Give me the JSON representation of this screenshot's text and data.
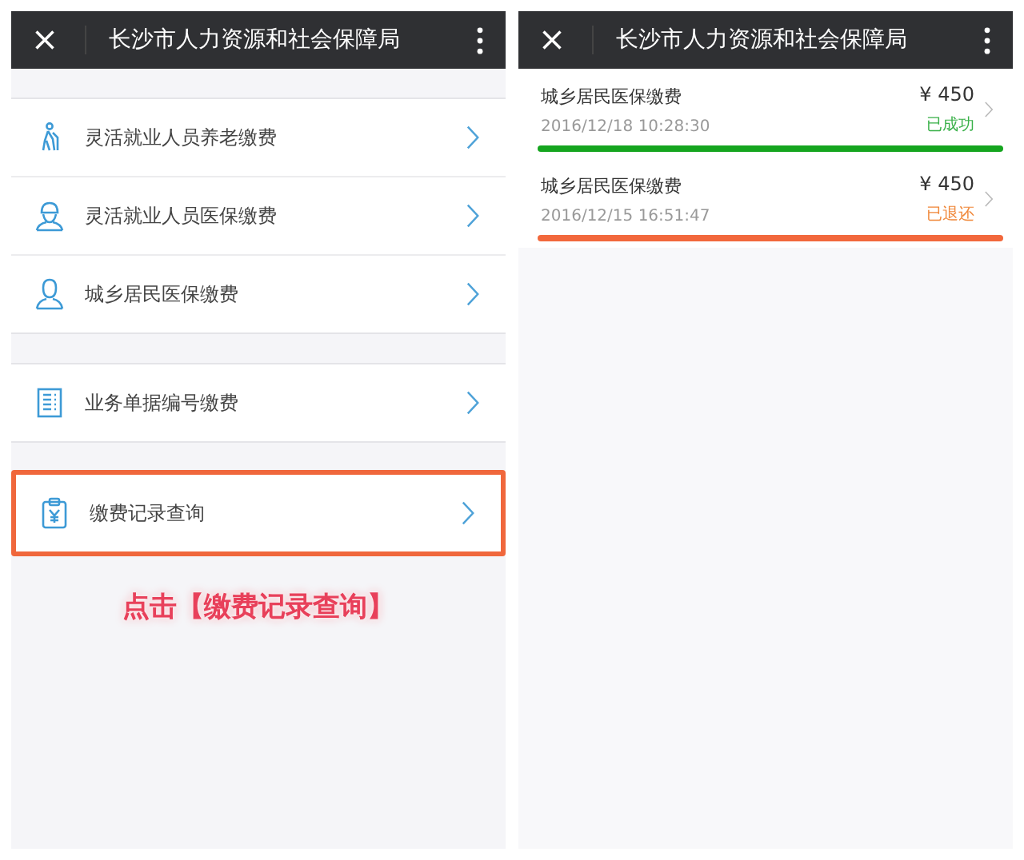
{
  "screens": [
    {
      "header": {
        "title": "长沙市人力资源和社会保障局"
      },
      "groups": [
        {
          "highlighted": false,
          "items": [
            {
              "label": "灵活就业人员养老缴费"
            },
            {
              "label": "灵活就业人员医保缴费"
            },
            {
              "label": "城乡居民医保缴费"
            }
          ]
        },
        {
          "highlighted": false,
          "items": [
            {
              "label": "业务单据编号缴费"
            }
          ]
        },
        {
          "highlighted": true,
          "items": [
            {
              "label": "缴费记录查询"
            }
          ]
        }
      ],
      "annotation": "点击【缴费记录查询】"
    },
    {
      "header": {
        "title": "长沙市人力资源和社会保障局"
      },
      "records": [
        {
          "title": "城乡居民医保缴费",
          "time": "2016/12/18 10:28:30",
          "amount": "¥ 450",
          "status": "已成功",
          "kind": "success",
          "color": "#15a51f"
        },
        {
          "title": "城乡居民医保缴费",
          "time": "2016/12/15 16:51:47",
          "amount": "¥ 450",
          "status": "已退还",
          "kind": "refunded",
          "color": "#f2683c"
        }
      ]
    }
  ]
}
